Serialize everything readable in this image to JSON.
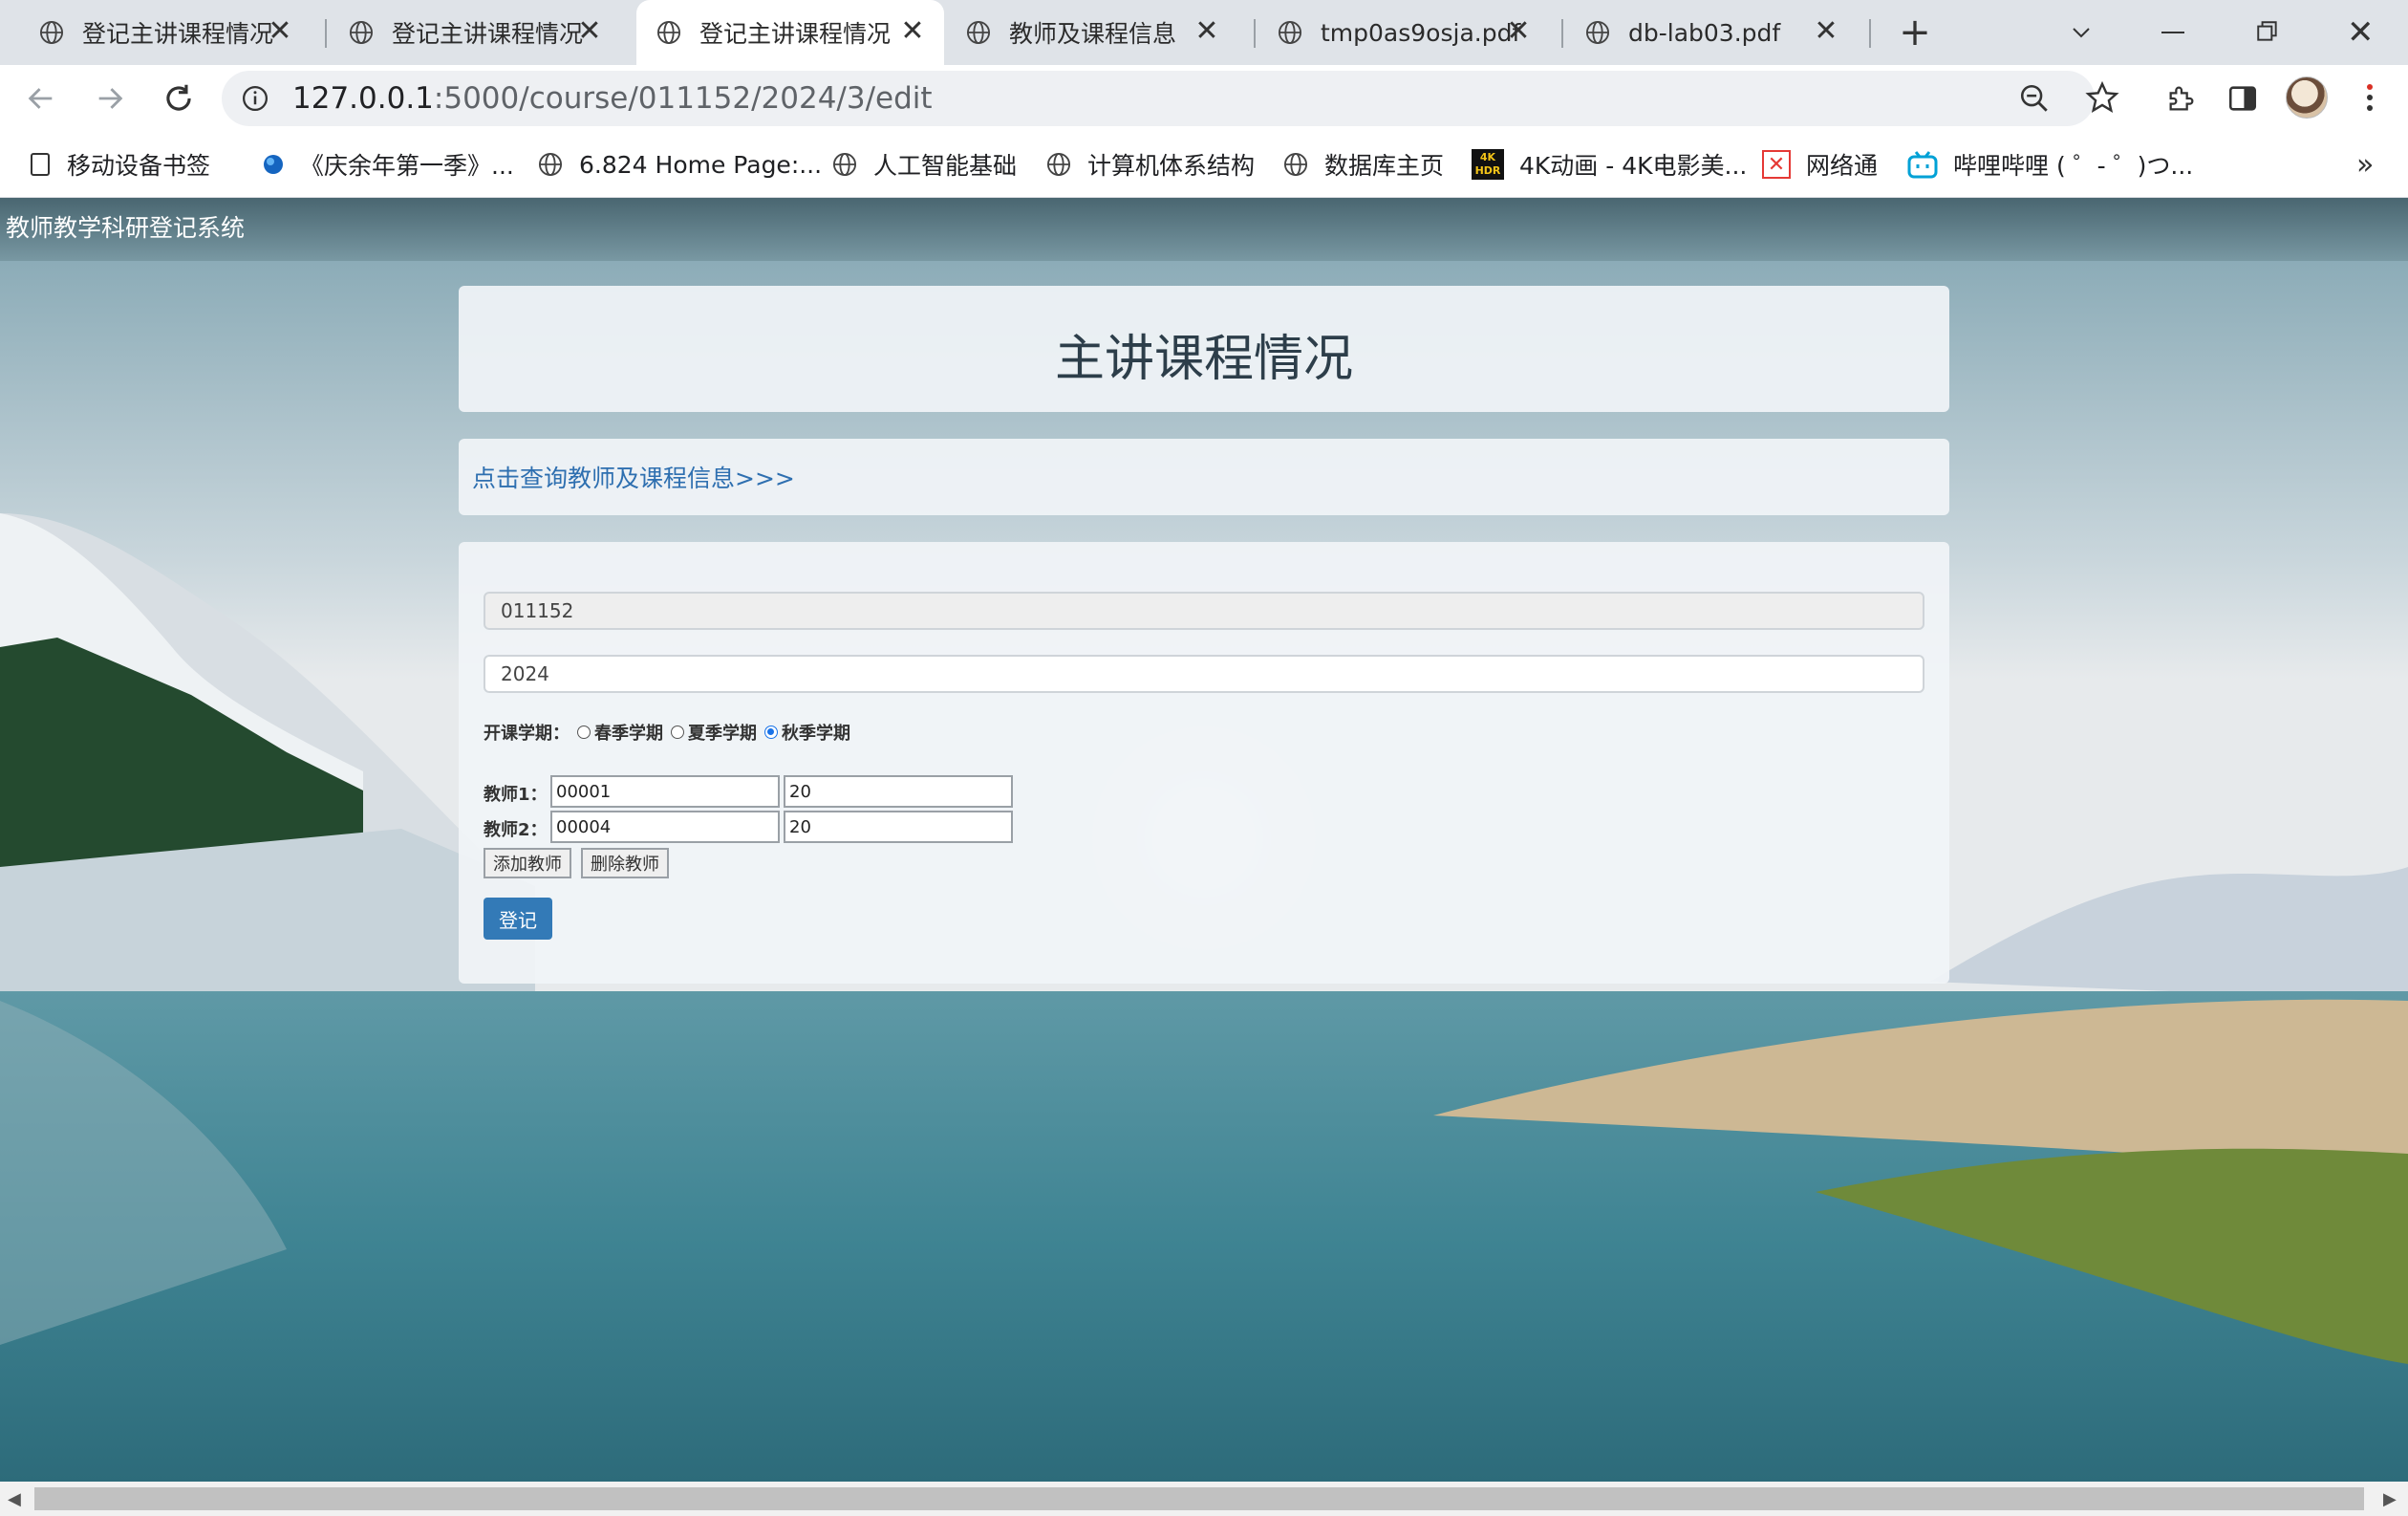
{
  "tabs": [
    {
      "title": "登记主讲课程情况",
      "active": false
    },
    {
      "title": "登记主讲课程情况",
      "active": false
    },
    {
      "title": "登记主讲课程情况",
      "active": true
    },
    {
      "title": "教师及课程信息",
      "active": false
    },
    {
      "title": "tmp0as9osja.pdf",
      "active": false
    },
    {
      "title": "db-lab03.pdf",
      "active": false
    }
  ],
  "address_bar": {
    "host": "127.0.0.1",
    "path": ":5000/course/011152/2024/3/edit"
  },
  "bookmarks": [
    {
      "label": "移动设备书签",
      "icon": "bookmark-square-icon"
    },
    {
      "label": "《庆余年第一季》...",
      "icon": "globe-blue-icon"
    },
    {
      "label": "6.824 Home Page:...",
      "icon": "globe-icon"
    },
    {
      "label": "人工智能基础",
      "icon": "globe-icon"
    },
    {
      "label": "计算机体系结构",
      "icon": "globe-icon"
    },
    {
      "label": "数据库主页",
      "icon": "globe-icon"
    },
    {
      "label": "4K动画 - 4K电影美...",
      "icon": "4k-hdr-icon"
    },
    {
      "label": "网络通",
      "icon": "wangluotong-icon"
    },
    {
      "label": "哔哩哔哩 ( ゜- ゜)つ...",
      "icon": "bilibili-icon"
    }
  ],
  "page": {
    "brand": "教师教学科研登记系统",
    "title": "主讲课程情况",
    "query_link": "点击查询教师及课程信息>>>",
    "course_id": "011152",
    "year": "2024",
    "semester_label": "开课学期：",
    "semesters": [
      {
        "label": "春季学期",
        "checked": false
      },
      {
        "label": "夏季学期",
        "checked": false
      },
      {
        "label": "秋季学期",
        "checked": true
      }
    ],
    "teachers": [
      {
        "label": "教师1：",
        "id": "00001",
        "hours": "20"
      },
      {
        "label": "教师2：",
        "id": "00004",
        "hours": "20"
      }
    ],
    "add_teacher_label": "添加教师",
    "remove_teacher_label": "删除教师",
    "submit_label": "登记"
  },
  "colors": {
    "accent": "#337ab7",
    "link": "#2e6fb0"
  }
}
